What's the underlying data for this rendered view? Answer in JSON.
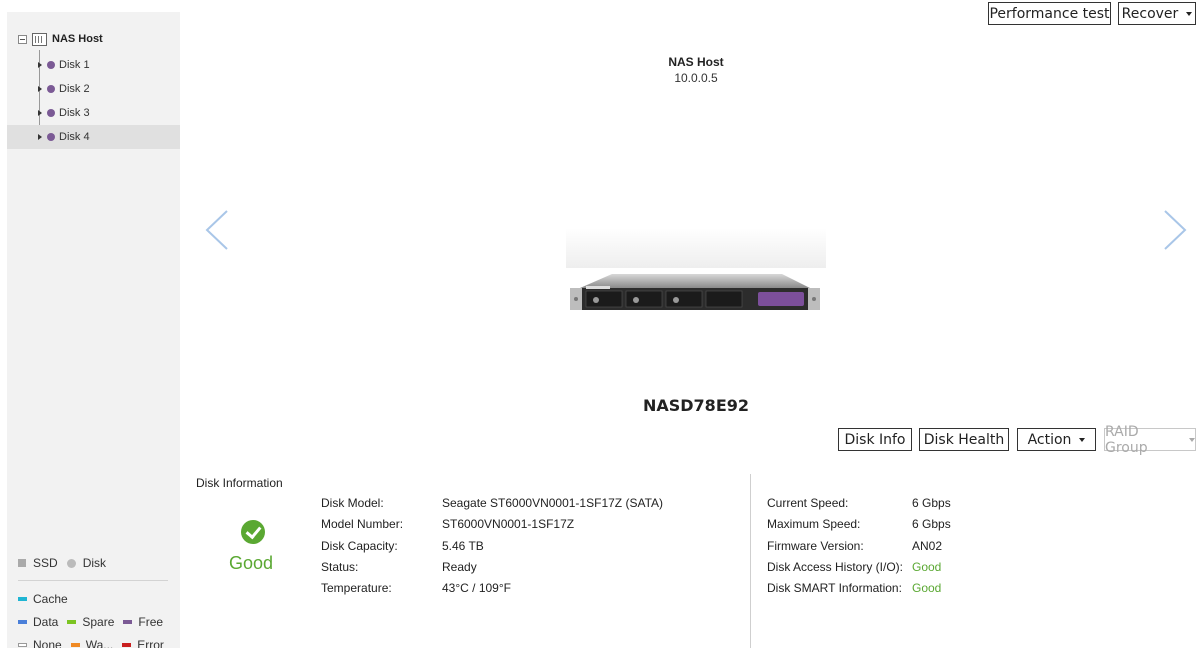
{
  "tree": {
    "root_label": "NAS Host",
    "disks": [
      {
        "label": "Disk 1"
      },
      {
        "label": "Disk 2"
      },
      {
        "label": "Disk 3"
      },
      {
        "label": "Disk 4",
        "selected": true
      }
    ]
  },
  "legend": {
    "ssd": "SSD",
    "disk": "Disk",
    "cache": "Cache",
    "data": "Data",
    "spare": "Spare",
    "free": "Free",
    "none": "None",
    "warning": "Wa...",
    "error": "Error",
    "colors": {
      "cache": "#1fb5d3",
      "data": "#4a7fd9",
      "spare": "#7cc422",
      "free": "#7b5a95",
      "warning": "#f08a24",
      "error": "#c91f1f"
    }
  },
  "toolbar": {
    "performance_test": "Performance test",
    "recover": "Recover"
  },
  "host": {
    "name": "NAS Host",
    "ip": "10.0.0.5",
    "device_name": "NASD78E92"
  },
  "disk_toolbar": {
    "disk_info": "Disk Info",
    "disk_health": "Disk Health",
    "action": "Action",
    "raid_group": "RAID Group"
  },
  "disk_information": {
    "title": "Disk Information",
    "status": "Good",
    "status_color": "#5aa832",
    "left": [
      {
        "label": "Disk Model:",
        "value": "Seagate ST6000VN0001-1SF17Z (SATA)"
      },
      {
        "label": "Model Number:",
        "value": "ST6000VN0001-1SF17Z"
      },
      {
        "label": "Disk Capacity:",
        "value": "5.46 TB"
      },
      {
        "label": "Status:",
        "value": "Ready"
      },
      {
        "label": "Temperature:",
        "value": "43°C / 109°F"
      }
    ],
    "right": [
      {
        "label": "Current Speed:",
        "value": "6 Gbps"
      },
      {
        "label": "Maximum Speed:",
        "value": "6 Gbps"
      },
      {
        "label": "Firmware Version:",
        "value": "AN02"
      },
      {
        "label": "Disk Access History (I/O):",
        "value": "Good"
      },
      {
        "label": "Disk SMART Information:",
        "value": "Good"
      }
    ]
  }
}
